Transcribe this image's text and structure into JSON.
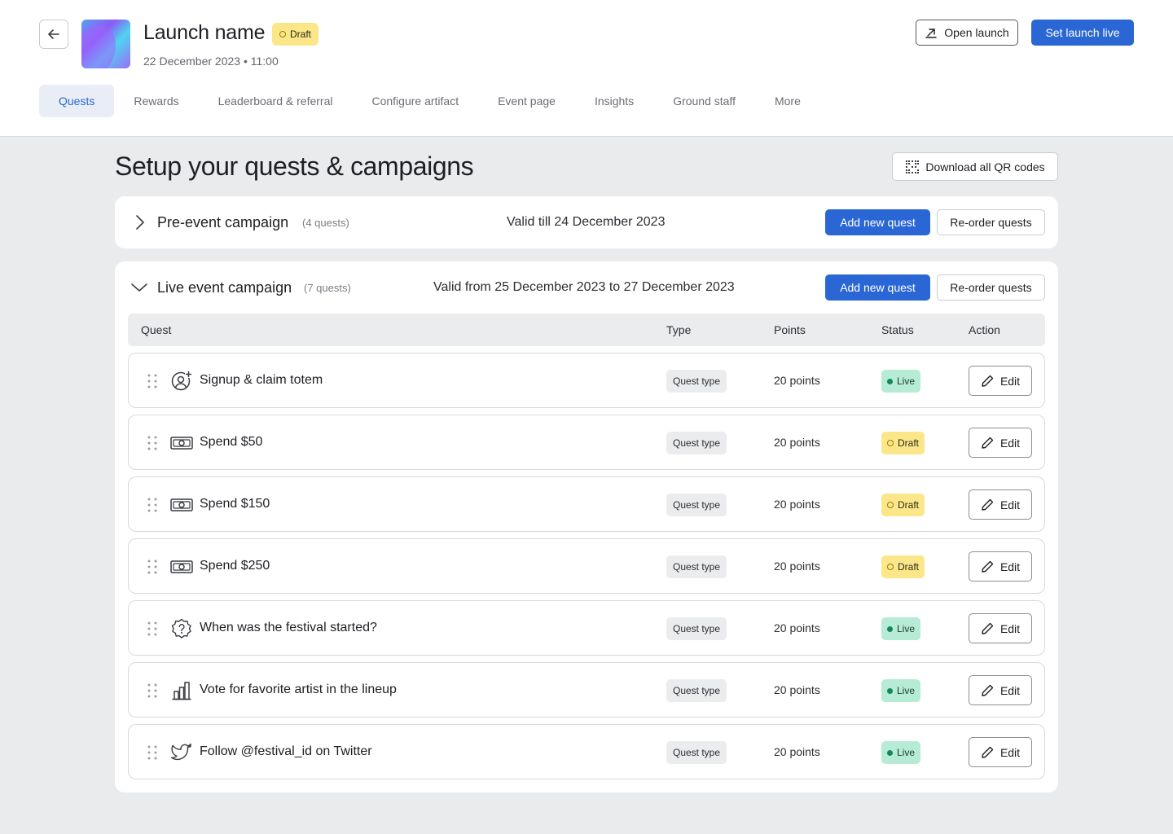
{
  "header": {
    "launch_title": "Launch name",
    "launch_status": "Draft",
    "launch_datetime": "22 December 2023 • 11:00",
    "open_launch_label": "Open launch",
    "set_live_label": "Set launch live"
  },
  "tabs": [
    {
      "label": "Quests",
      "active": true
    },
    {
      "label": "Rewards",
      "active": false
    },
    {
      "label": "Leaderboard & referral",
      "active": false
    },
    {
      "label": "Configure artifact",
      "active": false
    },
    {
      "label": "Event page",
      "active": false
    },
    {
      "label": "Insights",
      "active": false
    },
    {
      "label": "Ground staff",
      "active": false
    },
    {
      "label": "More",
      "active": false
    }
  ],
  "main": {
    "title": "Setup your quests & campaigns",
    "download_qr_label": "Download all QR codes"
  },
  "campaigns": {
    "pre_event": {
      "title": "Pre-event campaign",
      "count": "(4 quests)",
      "validity": "Valid till 24 December 2023",
      "add_label": "Add new quest",
      "reorder_label": "Re-order quests",
      "expanded": false
    },
    "live_event": {
      "title": "Live event campaign",
      "count": "(7 quests)",
      "validity": "Valid from 25 December 2023 to 27 December 2023",
      "add_label": "Add new quest",
      "reorder_label": "Re-order quests",
      "expanded": true
    }
  },
  "table": {
    "columns": [
      "Quest",
      "Type",
      "Points",
      "Status",
      "Action"
    ],
    "rows": [
      {
        "icon": "user-plus-icon",
        "name": "Signup & claim totem",
        "type": "Quest type",
        "points": "20 points",
        "status": "Live",
        "action": "Edit"
      },
      {
        "icon": "cash-icon",
        "name": "Spend $50",
        "type": "Quest type",
        "points": "20 points",
        "status": "Draft",
        "action": "Edit"
      },
      {
        "icon": "cash-icon",
        "name": "Spend $150",
        "type": "Quest type",
        "points": "20 points",
        "status": "Draft",
        "action": "Edit"
      },
      {
        "icon": "cash-icon",
        "name": "Spend $250",
        "type": "Quest type",
        "points": "20 points",
        "status": "Draft",
        "action": "Edit"
      },
      {
        "icon": "question-badge-icon",
        "name": "When was the festival started?",
        "type": "Quest type",
        "points": "20 points",
        "status": "Live",
        "action": "Edit"
      },
      {
        "icon": "bar-chart-icon",
        "name": "Vote for favorite artist in the lineup",
        "type": "Quest type",
        "points": "20 points",
        "status": "Live",
        "action": "Edit"
      },
      {
        "icon": "twitter-icon",
        "name": "Follow @festival_id on Twitter",
        "type": "Quest type",
        "points": "20 points",
        "status": "Live",
        "action": "Edit"
      }
    ]
  },
  "colors": {
    "primary": "#2b67d4",
    "live_bg": "#b6ebd5",
    "draft_bg": "#fbe78a",
    "page_bg": "#eaebed"
  }
}
